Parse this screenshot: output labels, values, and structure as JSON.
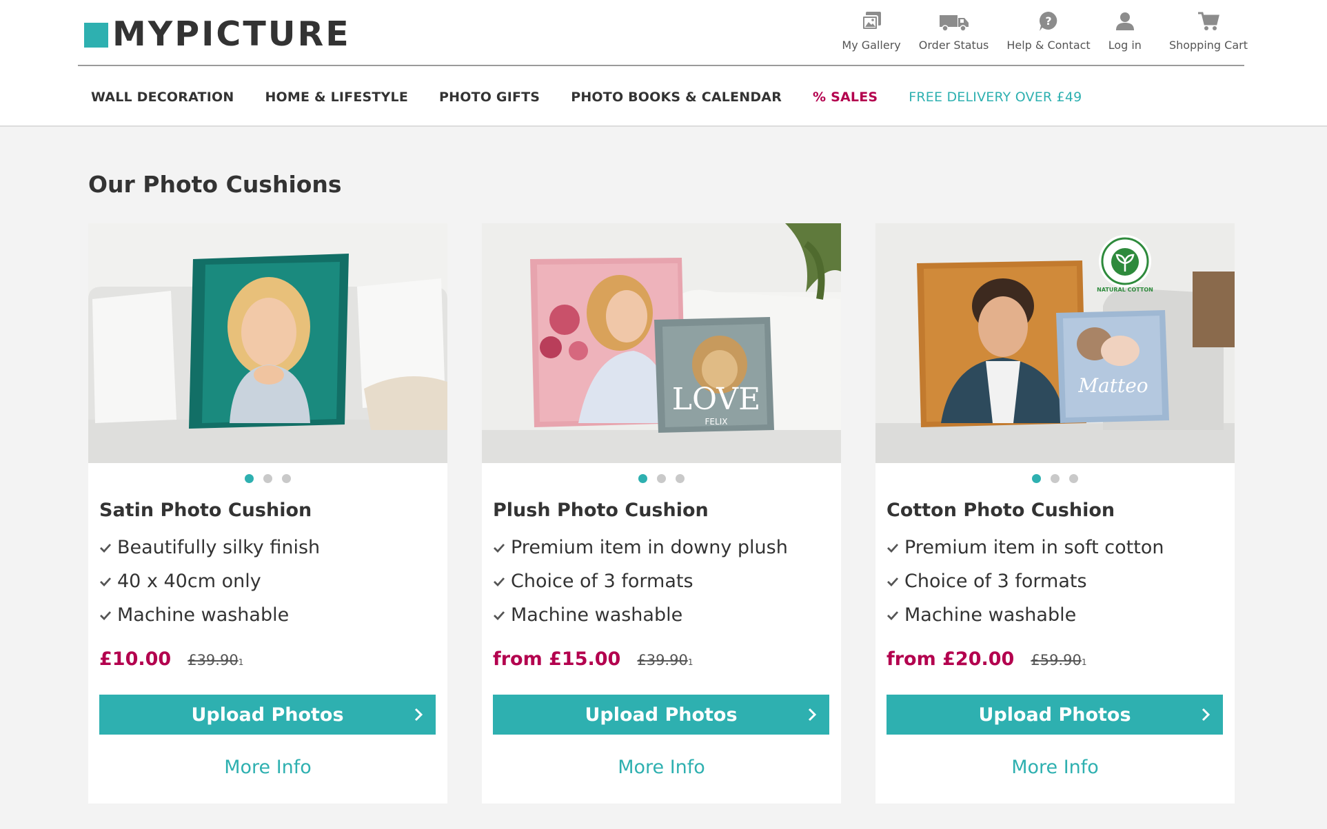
{
  "brand": {
    "name": "MYPICTURE",
    "accent": "#2eb0b0",
    "sale_color": "#b3004e"
  },
  "utility_nav": [
    {
      "label": "My Gallery",
      "icon": "gallery-icon"
    },
    {
      "label": "Order Status",
      "icon": "truck-icon"
    },
    {
      "label": "Help & Contact",
      "icon": "help-icon"
    },
    {
      "label": "Log in",
      "icon": "user-icon"
    },
    {
      "label": "Shopping Cart",
      "icon": "cart-icon"
    }
  ],
  "main_nav": [
    {
      "label": "WALL DECORATION"
    },
    {
      "label": "HOME & LIFESTYLE"
    },
    {
      "label": "PHOTO GIFTS"
    },
    {
      "label": "PHOTO BOOKS & CALENDAR"
    },
    {
      "label": "% SALES"
    },
    {
      "label": "FREE DELIVERY OVER £49"
    }
  ],
  "section_title": "Our Photo Cushions",
  "products": [
    {
      "title": "Satin Photo Cushion",
      "features": [
        "Beautifully silky finish",
        "40 x 40cm only",
        "Machine washable"
      ],
      "price": "£10.00",
      "old_price": "£39.90",
      "footnote": "1",
      "upload_label": "Upload Photos",
      "more_label": "More Info",
      "image": "satin-cushion-photo"
    },
    {
      "title": "Plush Photo Cushion",
      "features": [
        "Premium item in downy plush",
        "Choice of 3 formats",
        "Machine washable"
      ],
      "price": "from £15.00",
      "old_price": "£39.90",
      "footnote": "1",
      "upload_label": "Upload Photos",
      "more_label": "More Info",
      "image": "plush-cushion-photo",
      "image_text": "LOVE",
      "image_subtext": "FELIX"
    },
    {
      "title": "Cotton Photo Cushion",
      "features": [
        "Premium item in soft cotton",
        "Choice of 3 formats",
        "Machine washable"
      ],
      "price": "from £20.00",
      "old_price": "£59.90",
      "footnote": "1",
      "upload_label": "Upload Photos",
      "more_label": "More Info",
      "image": "cotton-cushion-photo",
      "badge_text": "NATURAL COTTON",
      "image_text": "Matteo"
    }
  ]
}
